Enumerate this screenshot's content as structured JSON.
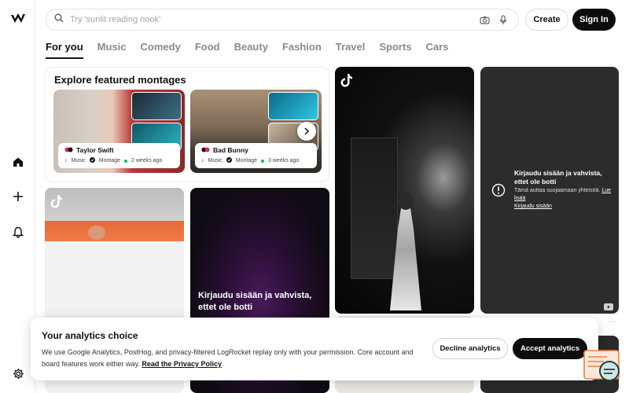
{
  "header": {
    "search_placeholder": "Try 'sunlit reading nook'",
    "create_label": "Create",
    "signin_label": "Sign In"
  },
  "tabs": [
    {
      "label": "For you",
      "active": true
    },
    {
      "label": "Music"
    },
    {
      "label": "Comedy"
    },
    {
      "label": "Food"
    },
    {
      "label": "Beauty"
    },
    {
      "label": "Fashion"
    },
    {
      "label": "Travel"
    },
    {
      "label": "Sports"
    },
    {
      "label": "Cars"
    }
  ],
  "featured": {
    "title": "Explore featured montages",
    "cards": [
      {
        "artist": "Taylor Swift",
        "genre": "Music",
        "type": "Montage",
        "age": "2 weeks ago"
      },
      {
        "artist": "Bad Bunny",
        "genre": "Music",
        "type": "Montage",
        "age": "3 weeks ago"
      }
    ]
  },
  "login_card": {
    "title": "Kirjaudu sisään ja vahvista, ettet ole botti",
    "subtitle": "Tämä auttaa suojaamaan yhteisöä.",
    "learn_more": "Lue lisää",
    "signin_link": "Kirjaudu sisään"
  },
  "overlay_card": {
    "title": "Kirjaudu sisään ja vahvista, ettet ole botti"
  },
  "consent": {
    "title": "Your analytics choice",
    "body": "We use Google Analytics, PostHog, and privacy-filtered LogRocket replay only with your permission. Core account and board features work either way.",
    "policy_link": "Read the Privacy Policy",
    "period": ".",
    "decline_label": "Decline analytics",
    "accept_label": "Accept analytics"
  },
  "more_label": "···",
  "colors": {
    "accent_dark": "#0d0d0d",
    "tab_inactive": "#8a8a8a",
    "status_green": "#1db954",
    "card_dark": "#2c2c2c"
  }
}
